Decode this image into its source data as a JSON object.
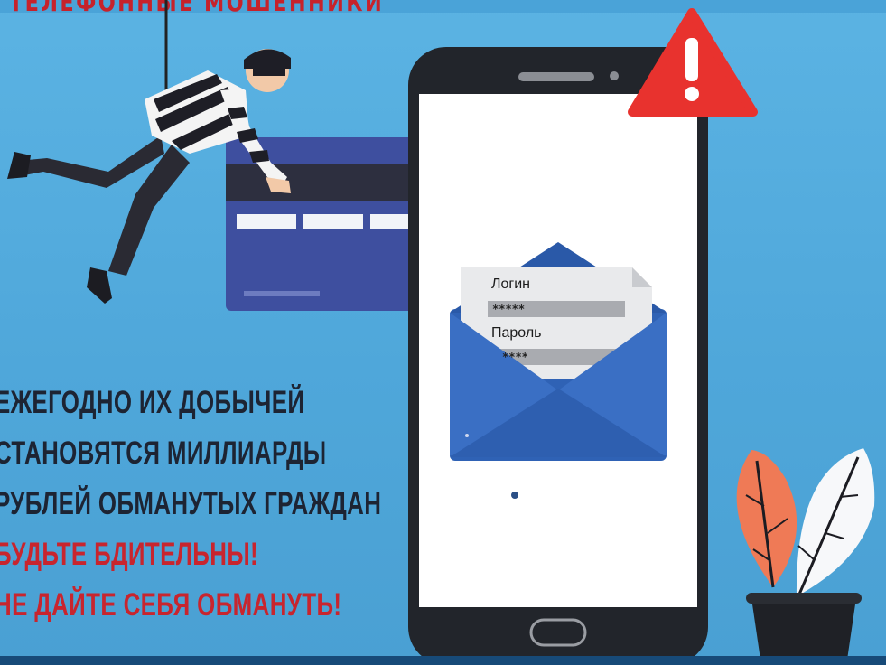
{
  "poster": {
    "top_title": "ТЕЛЕФОННЫЕ МОШЕННИКИ",
    "warning_lines": [
      "ЕЖЕГОДНО ИХ ДОБЫЧЕЙ",
      "СТАНОВЯТСЯ МИЛЛИАРДЫ",
      "РУБЛЕЙ ОБМАНУТЫХ ГРАЖДАН"
    ],
    "call_lines": [
      "БУДЬТЕ БДИТЕЛЬНЫ!",
      "НЕ ДАЙТЕ СЕБЯ ОБМАНУТЬ!"
    ]
  },
  "phone_screen": {
    "login_label": "Логин",
    "login_value": "*****",
    "password_label": "Пароль",
    "password_value": "****"
  },
  "icons": [
    "thief-figure",
    "bank-card",
    "smartphone",
    "warning-triangle-icon",
    "envelope-icon",
    "potted-plant"
  ],
  "colors": {
    "background": "#4fa7da",
    "alert_red": "#e8322e",
    "text_dark": "#1d2433",
    "text_red": "#c8252e",
    "card": "#3d4f9e",
    "envelope": "#2f62b5"
  }
}
